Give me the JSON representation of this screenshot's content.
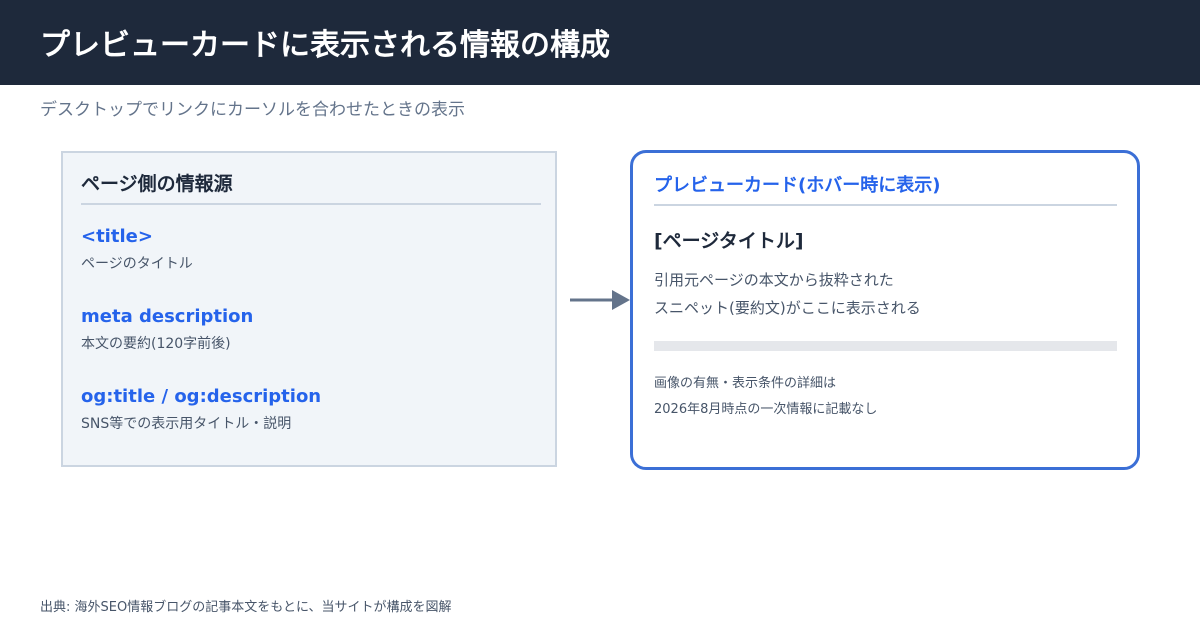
{
  "header": {
    "title": "プレビューカードに表示される情報の構成"
  },
  "subtitle": "デスクトップでリンクにカーソルを合わせたときの表示",
  "source_box": {
    "heading": "ページ側の情報源",
    "items": [
      {
        "name": "<title>",
        "desc": "ページのタイトル"
      },
      {
        "name": "meta description",
        "desc": "本文の要約(120字前後)"
      },
      {
        "name": "og:title / og:description",
        "desc": "SNS等での表示用タイトル・説明"
      }
    ]
  },
  "preview_card": {
    "heading": "プレビューカード(ホバー時に表示)",
    "page_title": "[ページタイトル]",
    "snippet_lines": [
      "引用元ページの本文から抜粋された",
      "スニペット(要約文)がここに表示される"
    ],
    "note_lines": [
      "画像の有無・表示条件の詳細は",
      "2026年8月時点の一次情報に記載なし"
    ]
  },
  "colors": {
    "header_bg": "#1e293b",
    "accent": "#2563eb",
    "card_border": "#3b6fd6",
    "arrow": "#64748b"
  },
  "icons": {
    "flow_arrow": "arrow-right-icon"
  },
  "footer": {
    "source": "出典: 海外SEO情報ブログの記事本文をもとに、当サイトが構成を図解"
  }
}
